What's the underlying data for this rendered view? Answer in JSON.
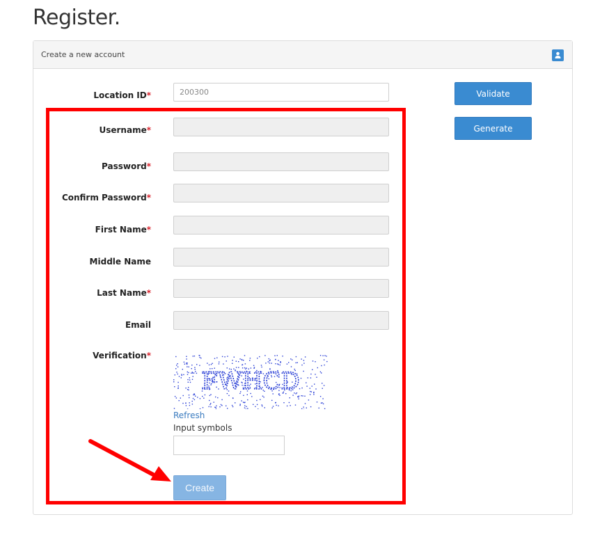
{
  "page": {
    "title": "Register."
  },
  "panel": {
    "heading": "Create a new account",
    "icon": "user-icon"
  },
  "form": {
    "location_id": {
      "label": "Location ID",
      "value": "200300"
    },
    "username": {
      "label": "Username",
      "value": ""
    },
    "password": {
      "label": "Password",
      "value": ""
    },
    "confirm_password": {
      "label": "Confirm Password",
      "value": ""
    },
    "first_name": {
      "label": "First Name",
      "value": ""
    },
    "middle_name": {
      "label": "Middle Name",
      "value": ""
    },
    "last_name": {
      "label": "Last Name",
      "value": ""
    },
    "email": {
      "label": "Email",
      "value": ""
    },
    "verification": {
      "label": "Verification",
      "captcha_text": "FWHCD",
      "refresh_label": "Refresh",
      "input_label": "Input symbols",
      "input_value": ""
    },
    "required_mark": "*"
  },
  "buttons": {
    "validate": "Validate",
    "generate": "Generate",
    "create": "Create"
  },
  "colors": {
    "accent": "#3a8bd1",
    "required": "#d9232d",
    "highlight": "#ff0000",
    "create_disabled": "#86b5e3"
  }
}
